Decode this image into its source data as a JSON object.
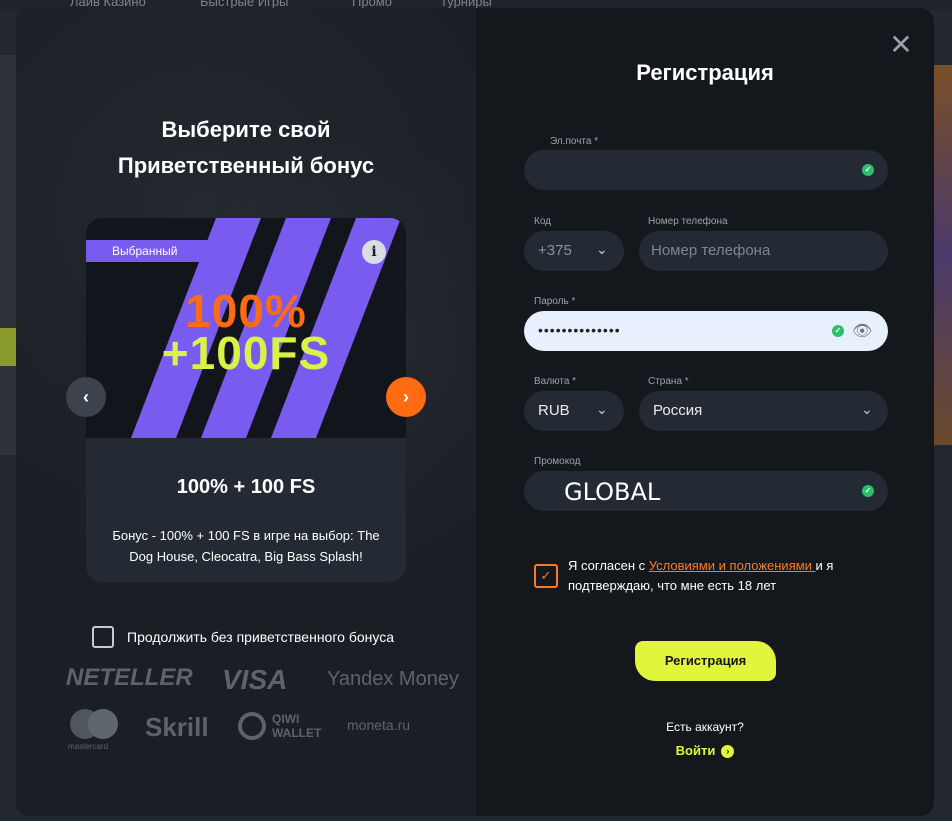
{
  "background": {
    "nav": [
      "Лайв Казино",
      "Быстрые Игры",
      "Промо",
      "Турниры"
    ]
  },
  "bonus": {
    "title_line1": "Выберите свой",
    "title_line2": "Приветственный бонус",
    "chosen_tag": "Выбранный",
    "info": "i",
    "promo_line1": "100%",
    "promo_line2": "+100FS",
    "name": "100% + 100 FS",
    "description": "Бонус - 100% + 100 FS в игре на выбор: The Dog House, Cleocatra, Big Bass Splash!",
    "prev": "‹",
    "next": "›",
    "skip_label": "Продолжить без приветственного бонуса"
  },
  "payments": [
    "NETELLER",
    "VISA",
    "Yandex Money",
    "mastercard",
    "Skrill",
    "QIWI WALLET",
    "moneta.ru"
  ],
  "form": {
    "close": "✕",
    "title": "Регистрация",
    "email_label": "Эл.почта *",
    "code_label": "Код",
    "code_value": "+375",
    "phone_label": "Номер телефона",
    "phone_placeholder": "Номер телефона",
    "password_label": "Пароль *",
    "password_value": "••••••••••••••",
    "currency_label": "Валюта *",
    "currency_value": "RUB",
    "country_label": "Страна *",
    "country_value": "Россия",
    "promo_label": "Промокод",
    "promo_value": "GLOBAL",
    "agree_prefix": "Я согласен с ",
    "agree_link": "Условиями и положениями ",
    "agree_suffix": "и я подтверждаю, что мне есть 18 лет",
    "submit": "Регистрация",
    "have_account": "Есть аккаунт?",
    "login": "Войти"
  },
  "colors": {
    "accent_orange": "#ff6b12",
    "accent_lime": "#e1f53c",
    "accent_purple": "#7a5bf0",
    "success": "#2cbf6a"
  }
}
